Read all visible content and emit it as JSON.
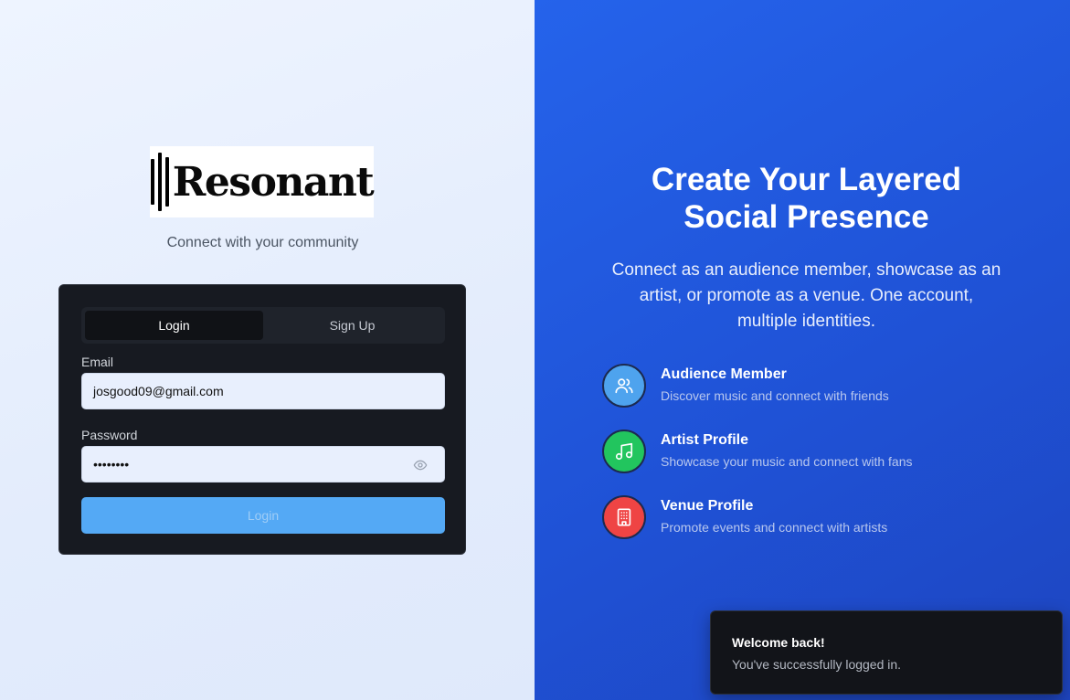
{
  "brand": {
    "name": "Resonant",
    "tagline": "Connect with your community"
  },
  "auth": {
    "tabs": [
      {
        "label": "Login",
        "active": true
      },
      {
        "label": "Sign Up",
        "active": false
      }
    ],
    "email": {
      "label": "Email",
      "value": "josgood09@gmail.com"
    },
    "password": {
      "label": "Password",
      "value": "••••••••"
    },
    "submit_label": "Login"
  },
  "hero": {
    "title_line1": "Create Your Layered",
    "title_line2": "Social Presence",
    "subtitle": "Connect as an audience member, showcase as an artist, or promote as a venue. One account, multiple identities."
  },
  "features": [
    {
      "icon": "users-icon",
      "title": "Audience Member",
      "desc": "Discover music and connect with friends",
      "color": "#4ea3ee"
    },
    {
      "icon": "music-note-icon",
      "title": "Artist Profile",
      "desc": "Showcase your music and connect with fans",
      "color": "#22c55e"
    },
    {
      "icon": "building-icon",
      "title": "Venue Profile",
      "desc": "Promote events and connect with artists",
      "color": "#ef4444"
    }
  ],
  "toast": {
    "title": "Welcome back!",
    "message": "You've successfully logged in."
  },
  "colors": {
    "accent_blue": "#2563eb",
    "button_blue": "#54a9f5",
    "card_bg": "#171a21"
  }
}
